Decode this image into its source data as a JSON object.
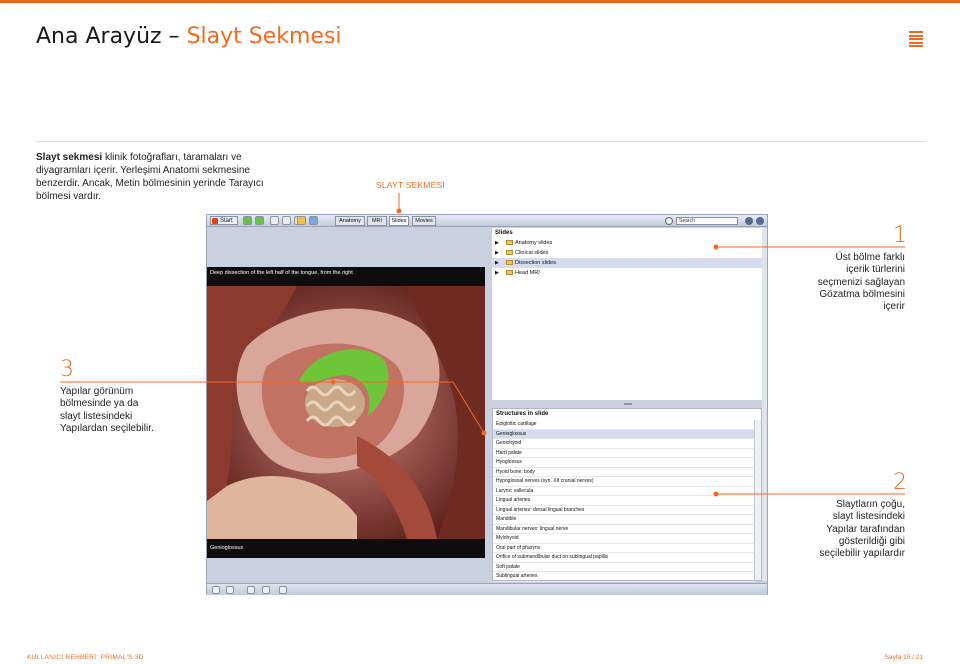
{
  "page": {
    "title_main": "Ana Arayüz –",
    "title_accent": "Slayt Sekmesi",
    "intro_bold": "Slayt sekmesi",
    "intro_rest": " klinik fotoğrafları, taramaları ve diyagramları içerir. Yerleşimi Anatomi sekmesine benzerdir. Ancak, Metin bölmesinin yerinde Tarayıcı bölmesi vardır.",
    "slide_tab_label": "SLAYT SEKMESİ",
    "footer_left": "KULLANICI REHBERİ: PRIMAL'S 3D",
    "footer_right": "Sayfa 15 / 21"
  },
  "callouts": [
    {
      "num": "1",
      "text": "Üst bölme farklı içerik türlerini seçmenizi sağlayan Gözatma bölmesini içerir"
    },
    {
      "num": "2",
      "text": "Slaytların çoğu, slayt listesindeki Yapılar tarafından gösterildiği gibi seçilebilir yapılardır"
    },
    {
      "num": "3",
      "text": "Yapılar görünüm bölmesinde ya da slayt listesindeki Yapılardan seçilebilir."
    }
  ],
  "app": {
    "start_label": "Start",
    "tabs": [
      "Anatomy",
      "MRI",
      "Slides",
      "Movies"
    ],
    "active_tab": "Slides",
    "search_value": "Search",
    "image_caption_top": "Deep dissection of the left half of the tongue, from the right",
    "image_caption_bottom": "Genioglossus",
    "slides_header": "Slides",
    "slides_items": [
      "Anatomy slides",
      "Clinical slides",
      "Dissection slides",
      "Head MRI"
    ],
    "slides_selected": "Dissection slides",
    "structures_header": "Structures in slide",
    "structures": [
      "Epiglottic cartilage",
      "Genioglossus",
      "Geniohyoid",
      "Hard palate",
      "Hyoglossus",
      "Hyoid bone: body",
      "Hypoglossal nerves (syn. XII cranial nerves)",
      "Larynx: vallecula",
      "Lingual arteries",
      "Lingual arteries: dorsal lingual branches",
      "Mandible",
      "Mandibular nerves: lingual nerve",
      "Mylohyoid",
      "Oral part of pharynx",
      "Orifice of submandibular duct on sublingual papilla",
      "Soft palate",
      "Sublingual arteries"
    ],
    "structures_selected": "Genioglossus"
  },
  "colors": {
    "accent": "#f26a21",
    "selection": "#d6dcef",
    "highlight_green": "#66cc33"
  }
}
